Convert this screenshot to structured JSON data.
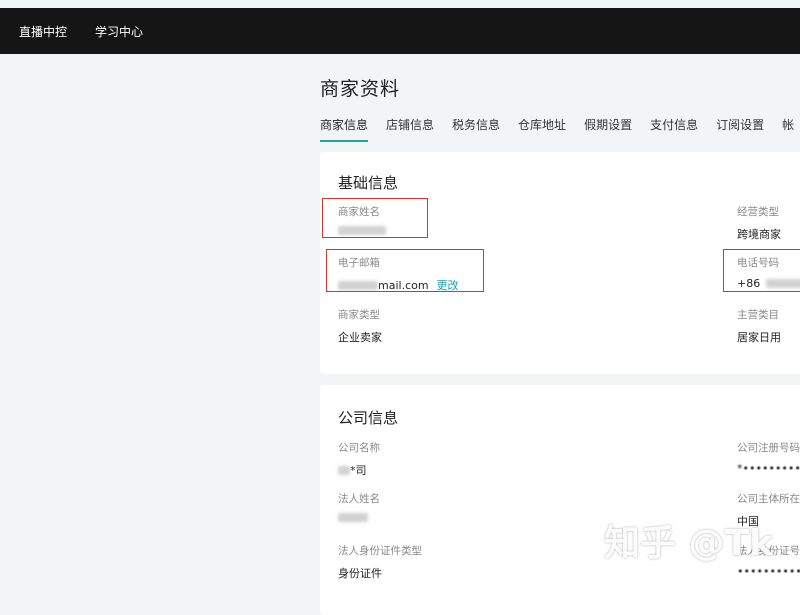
{
  "topnav": {
    "items": [
      "直播中控",
      "学习中心"
    ]
  },
  "page": {
    "title": "商家资料"
  },
  "tabs": [
    "商家信息",
    "店铺信息",
    "税务信息",
    "仓库地址",
    "假期设置",
    "支付信息",
    "订阅设置",
    "帐"
  ],
  "basic_info": {
    "title": "基础信息",
    "merchant_name": {
      "label": "商家姓名",
      "value": ""
    },
    "business_type": {
      "label": "经营类型",
      "value": "跨境商家"
    },
    "email": {
      "label": "电子邮箱",
      "value_suffix": "mail.com",
      "action": "更改"
    },
    "phone": {
      "label": "电话号码",
      "value_prefix": "+86"
    },
    "merchant_type": {
      "label": "商家类型",
      "value": "企业卖家"
    },
    "main_category": {
      "label": "主营类目",
      "value": "居家日用"
    }
  },
  "company_info": {
    "title": "公司信息",
    "company_name": {
      "label": "公司名称",
      "value_suffix": "*司"
    },
    "reg_number": {
      "label": "公司注册号码",
      "value": "*••••••••••"
    },
    "legal_name": {
      "label": "法人姓名",
      "value": ""
    },
    "company_location": {
      "label": "公司主体所在",
      "value": "中国"
    },
    "id_type": {
      "label": "法人身份证件类型",
      "value": "身份证件"
    },
    "id_number": {
      "label": "法人身份证号",
      "value": "••••••••••"
    }
  },
  "watermark": "知乎 @Tk",
  "colors": {
    "topbar": "#151515",
    "accent": "#1aa2a8",
    "highlight": "#d9342b"
  }
}
